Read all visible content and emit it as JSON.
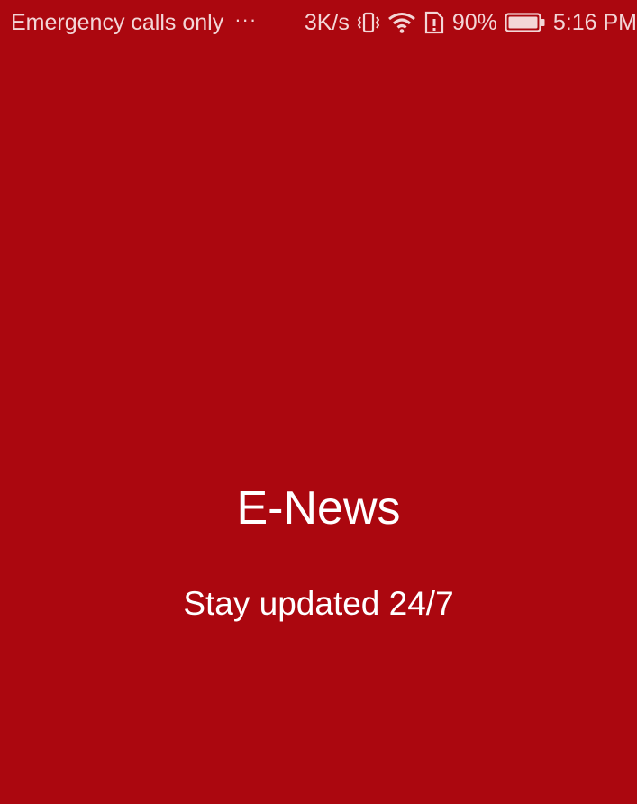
{
  "status_bar": {
    "carrier_text": "Emergency calls only",
    "overflow_indicator": "···",
    "network_speed": "3K/s",
    "battery_percent": "90%",
    "battery_level": 0.9,
    "time": "5:16 PM",
    "icons": [
      "vibrate-icon",
      "wifi-icon",
      "sim-alert-icon",
      "battery-icon"
    ]
  },
  "splash": {
    "title": "E-News",
    "tagline": "Stay updated 24/7"
  },
  "colors": {
    "background": "#AB070F",
    "text": "#FFFFFF",
    "status_text": "#F3D6D7"
  }
}
